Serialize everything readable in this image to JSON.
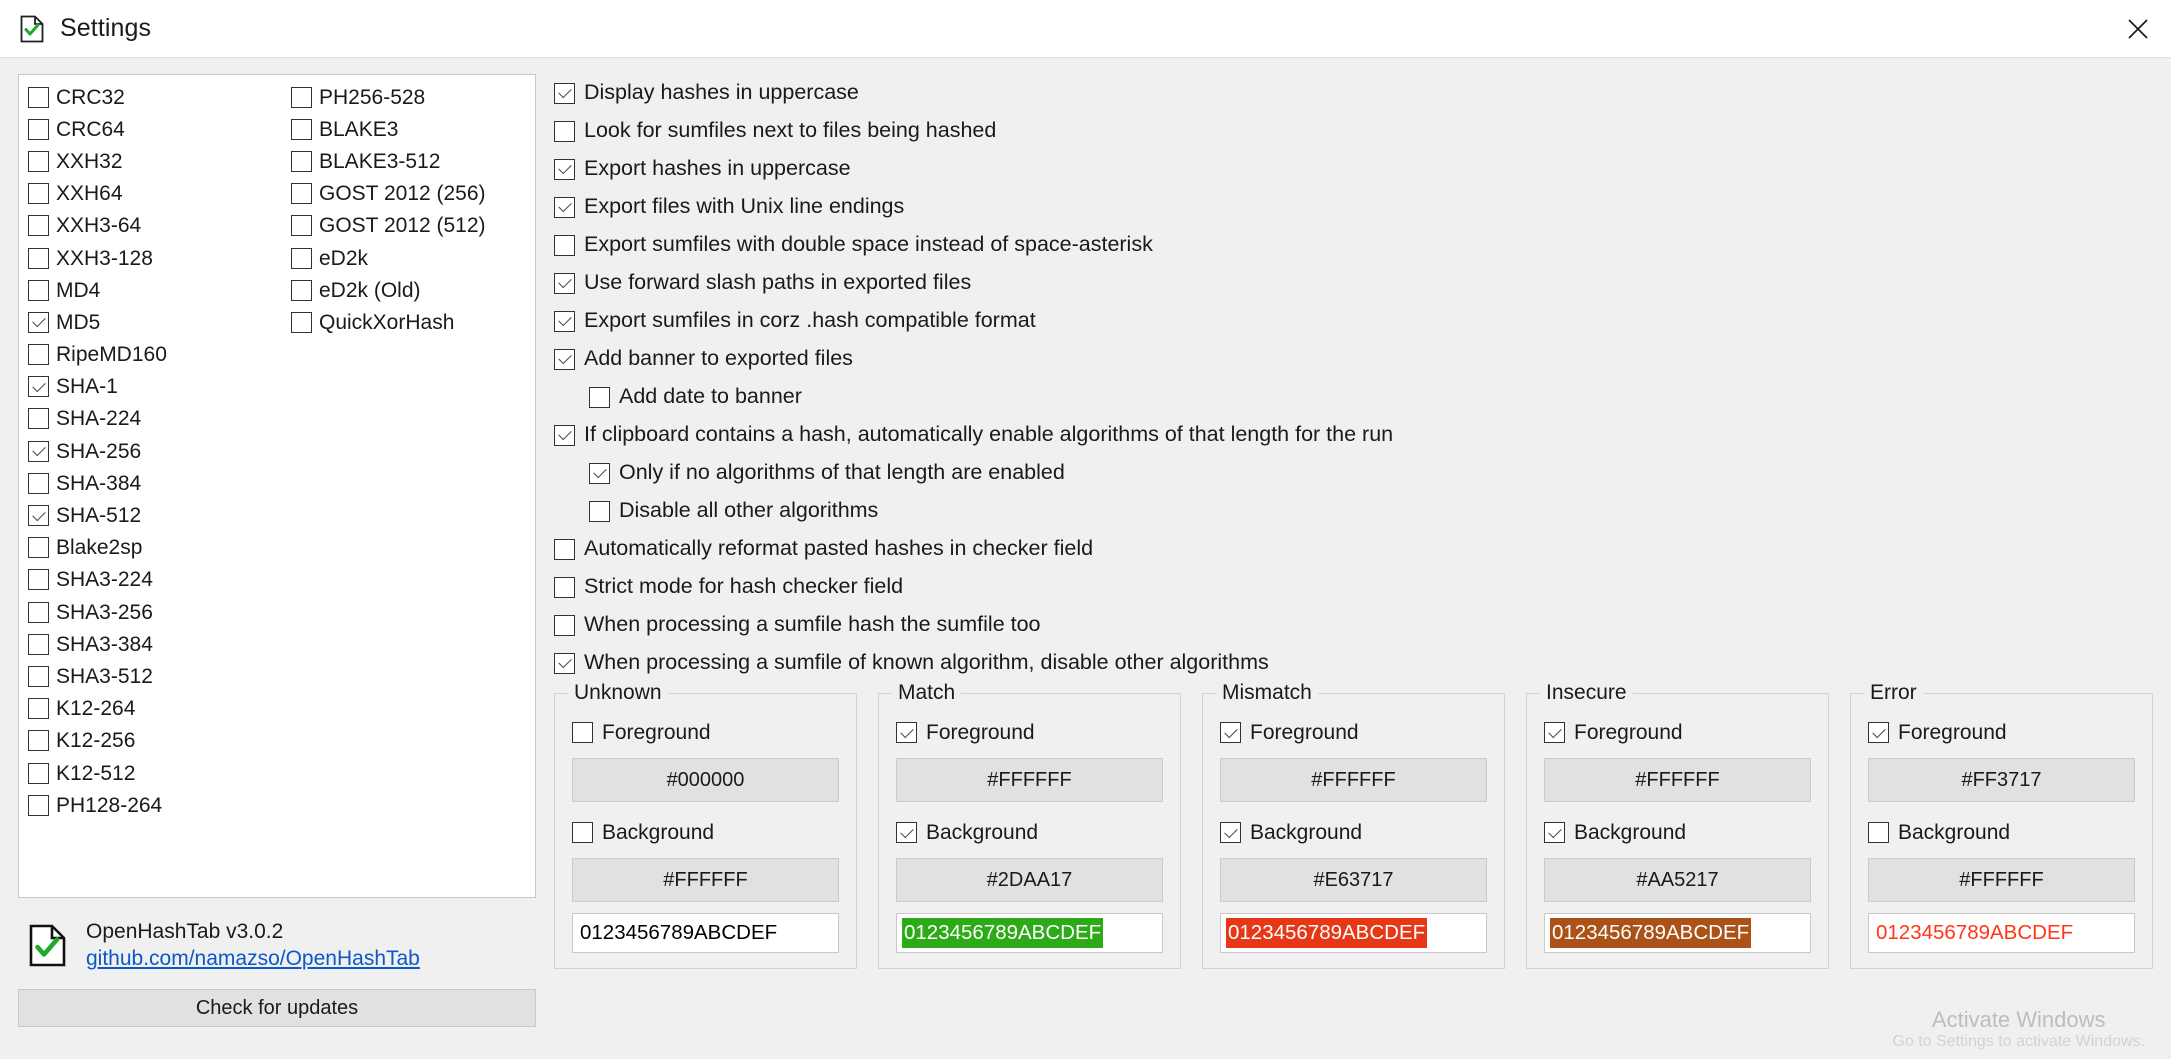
{
  "window": {
    "title": "Settings",
    "icon": "document-check-icon",
    "close_label": "✕"
  },
  "algorithms": {
    "column1": [
      {
        "label": "CRC32",
        "checked": false
      },
      {
        "label": "CRC64",
        "checked": false
      },
      {
        "label": "XXH32",
        "checked": false
      },
      {
        "label": "XXH64",
        "checked": false
      },
      {
        "label": "XXH3-64",
        "checked": false
      },
      {
        "label": "XXH3-128",
        "checked": false
      },
      {
        "label": "MD4",
        "checked": false
      },
      {
        "label": "MD5",
        "checked": true
      },
      {
        "label": "RipeMD160",
        "checked": false
      },
      {
        "label": "SHA-1",
        "checked": true
      },
      {
        "label": "SHA-224",
        "checked": false
      },
      {
        "label": "SHA-256",
        "checked": true
      },
      {
        "label": "SHA-384",
        "checked": false
      },
      {
        "label": "SHA-512",
        "checked": true
      },
      {
        "label": "Blake2sp",
        "checked": false
      },
      {
        "label": "SHA3-224",
        "checked": false
      },
      {
        "label": "SHA3-256",
        "checked": false
      },
      {
        "label": "SHA3-384",
        "checked": false
      },
      {
        "label": "SHA3-512",
        "checked": false
      },
      {
        "label": "K12-264",
        "checked": false
      },
      {
        "label": "K12-256",
        "checked": false
      },
      {
        "label": "K12-512",
        "checked": false
      },
      {
        "label": "PH128-264",
        "checked": false
      }
    ],
    "column2": [
      {
        "label": "PH256-528",
        "checked": false
      },
      {
        "label": "BLAKE3",
        "checked": false
      },
      {
        "label": "BLAKE3-512",
        "checked": false
      },
      {
        "label": "GOST 2012 (256)",
        "checked": false
      },
      {
        "label": "GOST 2012 (512)",
        "checked": false
      },
      {
        "label": "eD2k",
        "checked": false
      },
      {
        "label": "eD2k (Old)",
        "checked": false
      },
      {
        "label": "QuickXorHash",
        "checked": false
      }
    ]
  },
  "about": {
    "icon": "document-check-icon",
    "product": "OpenHashTab v3.0.2",
    "link": "github.com/namazso/OpenHashTab",
    "update_button": "Check for updates"
  },
  "options": [
    {
      "label": "Display hashes in uppercase",
      "checked": true,
      "indent": 0
    },
    {
      "label": "Look for sumfiles next to files being hashed",
      "checked": false,
      "indent": 0
    },
    {
      "label": "Export hashes in uppercase",
      "checked": true,
      "indent": 0
    },
    {
      "label": "Export files with Unix line endings",
      "checked": true,
      "indent": 0
    },
    {
      "label": "Export sumfiles with double space instead of space-asterisk",
      "checked": false,
      "indent": 0
    },
    {
      "label": "Use forward slash paths in exported files",
      "checked": true,
      "indent": 0
    },
    {
      "label": "Export sumfiles in corz .hash compatible format",
      "checked": true,
      "indent": 0
    },
    {
      "label": "Add banner to exported files",
      "checked": true,
      "indent": 0
    },
    {
      "label": "Add date to banner",
      "checked": false,
      "indent": 1
    },
    {
      "label": "If clipboard contains a hash, automatically enable algorithms of that length for the run",
      "checked": true,
      "indent": 0
    },
    {
      "label": "Only if no algorithms of that length are enabled",
      "checked": true,
      "indent": 1
    },
    {
      "label": "Disable all other algorithms",
      "checked": false,
      "indent": 1
    },
    {
      "label": "Automatically reformat pasted hashes in checker field",
      "checked": false,
      "indent": 0
    },
    {
      "label": "Strict mode for hash checker field",
      "checked": false,
      "indent": 0
    },
    {
      "label": "When processing a sumfile hash the sumfile too",
      "checked": false,
      "indent": 0
    },
    {
      "label": "When processing a sumfile of known algorithm, disable other algorithms",
      "checked": true,
      "indent": 0
    }
  ],
  "color_groups": [
    {
      "title": "Unknown",
      "foreground_label": "Foreground",
      "foreground_checked": false,
      "foreground_hex": "#000000",
      "background_label": "Background",
      "background_checked": false,
      "background_hex": "#FFFFFF",
      "preview_text": "0123456789ABCDEF",
      "preview_fg": "#000000",
      "preview_bg": "#FFFFFF"
    },
    {
      "title": "Match",
      "foreground_label": "Foreground",
      "foreground_checked": true,
      "foreground_hex": "#FFFFFF",
      "background_label": "Background",
      "background_checked": true,
      "background_hex": "#2DAA17",
      "preview_text": "0123456789ABCDEF",
      "preview_fg": "#FFFFFF",
      "preview_bg": "#2DAA17"
    },
    {
      "title": "Mismatch",
      "foreground_label": "Foreground",
      "foreground_checked": true,
      "foreground_hex": "#FFFFFF",
      "background_label": "Background",
      "background_checked": true,
      "background_hex": "#E63717",
      "preview_text": "0123456789ABCDEF",
      "preview_fg": "#FFFFFF",
      "preview_bg": "#E63717"
    },
    {
      "title": "Insecure",
      "foreground_label": "Foreground",
      "foreground_checked": true,
      "foreground_hex": "#FFFFFF",
      "background_label": "Background",
      "background_checked": true,
      "background_hex": "#AA5217",
      "preview_text": "0123456789ABCDEF",
      "preview_fg": "#FFFFFF",
      "preview_bg": "#AA5217"
    },
    {
      "title": "Error",
      "foreground_label": "Foreground",
      "foreground_checked": true,
      "foreground_hex": "#FF3717",
      "background_label": "Background",
      "background_checked": false,
      "background_hex": "#FFFFFF",
      "preview_text": "0123456789ABCDEF",
      "preview_fg": "#FF3717",
      "preview_bg": "#FFFFFF"
    }
  ],
  "watermark": {
    "line1": "Activate Windows",
    "line2": "Go to Settings to activate Windows."
  }
}
